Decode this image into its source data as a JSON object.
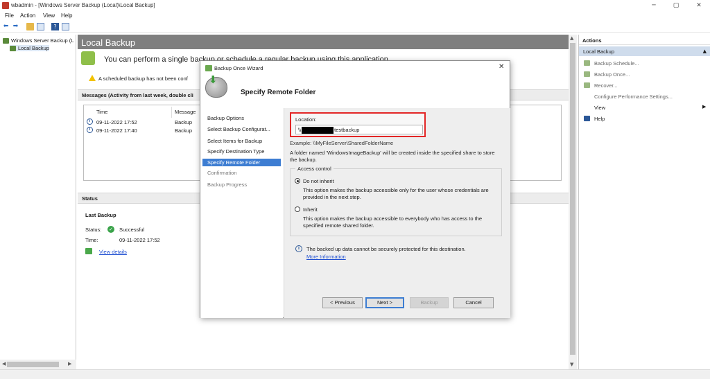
{
  "window": {
    "title": "wbadmin - [Windows Server Backup (Local)\\Local Backup]",
    "min_icon": "minimize-icon",
    "max_icon": "maximize-icon",
    "close_icon": "close-icon"
  },
  "menu": [
    "File",
    "Action",
    "View",
    "Help"
  ],
  "toolbar": [
    "back-arrow-icon",
    "forward-arrow-icon",
    "up-folder-icon",
    "console-tree-icon",
    "help-icon",
    "panel-icon"
  ],
  "tree": {
    "root": "Windows Server Backup (L",
    "child": "Local Backup"
  },
  "main": {
    "header": "Local Backup",
    "welcome": "You can perform a single backup or schedule a regular backup using this application.",
    "warning": "A scheduled backup has not been conf",
    "messages_header": "Messages (Activity from last week, double cli",
    "columns": {
      "time": "Time",
      "message": "Message"
    },
    "rows": [
      {
        "time": "09-11-2022 17:52",
        "message": "Backup"
      },
      {
        "time": "09-11-2022 17:40",
        "message": "Backup"
      }
    ],
    "status_header": "Status",
    "last_backup": "Last Backup",
    "status_label": "Status:",
    "status_value": "Successful",
    "time_label": "Time:",
    "time_value": "09-11-2022 17:52",
    "view_details": "View details"
  },
  "actions": {
    "title": "Actions",
    "section": "Local Backup",
    "items": [
      "Backup Schedule...",
      "Backup Once...",
      "Recover...",
      "Configure Performance Settings...",
      "View",
      "Help"
    ]
  },
  "dialog": {
    "title": "Backup Once Wizard",
    "heading": "Specify Remote Folder",
    "nav": [
      "Backup Options",
      "Select Backup Configurat...",
      "Select Items for Backup",
      "Specify Destination Type",
      "Specify Remote Folder",
      "Confirmation",
      "Backup Progress"
    ],
    "location_label": "Location:",
    "location_prefix": "\\\\",
    "location_suffix": "testbackup",
    "example": "Example: \\\\MyFileServer\\SharedFolderName",
    "note": "A folder named 'WindowsImageBackup' will be created inside the specified share to store the backup.",
    "access_control": "Access control",
    "opt1_label": "Do not inherit",
    "opt1_desc": "This option makes the backup accessible only for the user whose credentials are provided in the next step.",
    "opt2_label": "Inherit",
    "opt2_desc": "This option makes the backup accessible to everybody who has access to the specified remote shared folder.",
    "info": "The backed up data cannot be securely protected for this destination.",
    "more_info": "More Information",
    "buttons": {
      "previous": "< Previous",
      "next": "Next >",
      "backup": "Backup",
      "cancel": "Cancel"
    }
  }
}
